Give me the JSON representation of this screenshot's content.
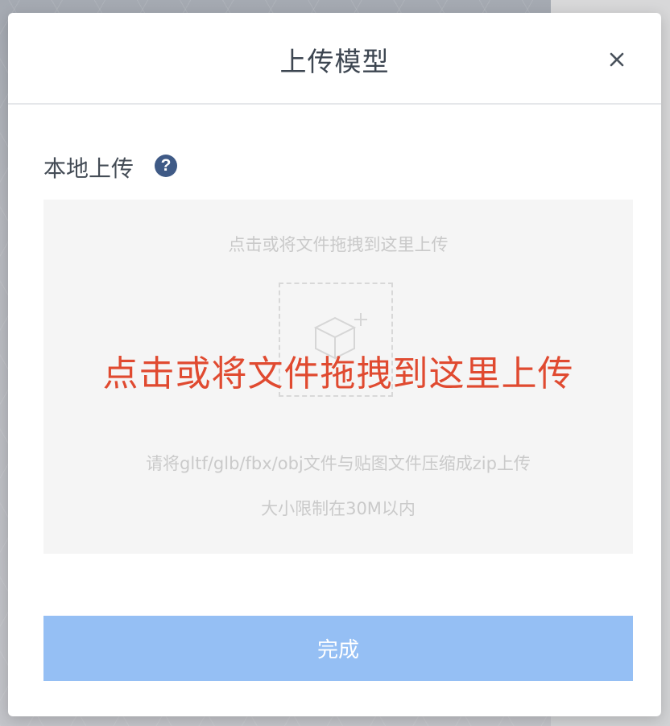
{
  "dialog": {
    "title": "上传模型",
    "close_icon": "close-icon"
  },
  "section": {
    "label": "本地上传",
    "help_icon": "question-circle-icon",
    "help_glyph": "?"
  },
  "dropzone": {
    "hint_top": "点击或将文件拖拽到这里上传",
    "upload_icon": "cube-plus-icon",
    "overlay_text": "点击或将文件拖拽到这里上传",
    "formats_hint": "请将gltf/glb/fbx/obj文件与贴图文件压缩成zip上传",
    "size_hint": "大小限制在30M以内"
  },
  "footer": {
    "done_label": "完成"
  },
  "colors": {
    "primary_button": "#95bff4",
    "overlay_text": "#e04a30",
    "help_icon": "#3f5a86"
  }
}
